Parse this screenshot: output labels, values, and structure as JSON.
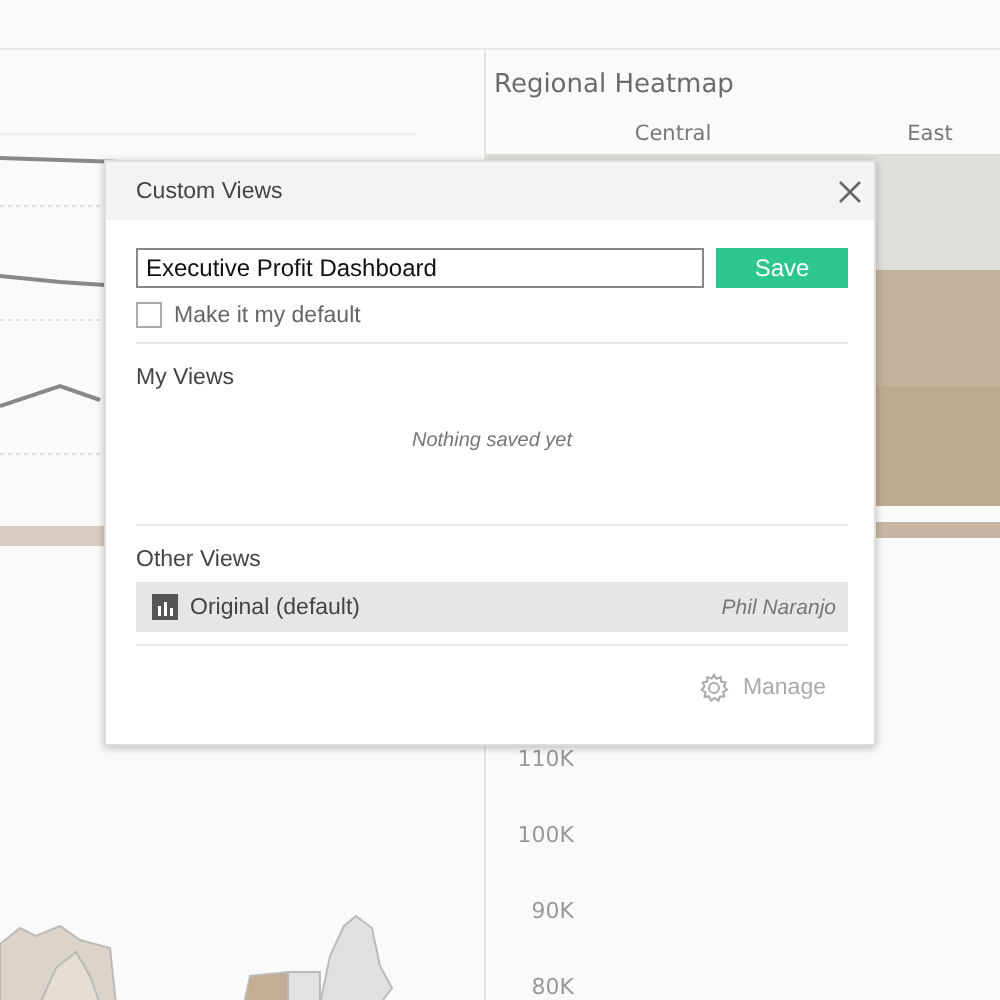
{
  "dashboard": {
    "heatmap": {
      "title": "Regional Heatmap",
      "columns": [
        "Central",
        "East"
      ]
    },
    "axis_labels": [
      "110K",
      "100K",
      "90K",
      "80K"
    ]
  },
  "dialog": {
    "title": "Custom Views",
    "name_field": {
      "value": "Executive Profit Dashboard"
    },
    "save_button": "Save",
    "default_checkbox": {
      "label": "Make it my default",
      "checked": false
    },
    "my_views": {
      "heading": "My Views",
      "empty_message": "Nothing saved yet"
    },
    "other_views": {
      "heading": "Other Views",
      "items": [
        {
          "name": "Original (default)",
          "owner": "Phil Naranjo",
          "selected": true
        }
      ]
    },
    "manage_button": "Manage"
  }
}
